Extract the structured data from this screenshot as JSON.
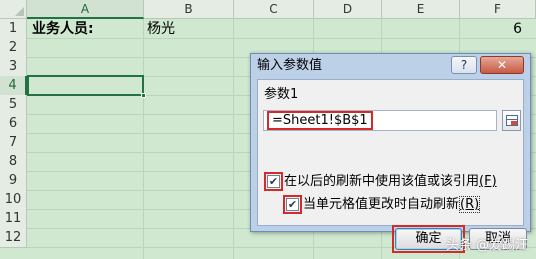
{
  "spreadsheet": {
    "columns": [
      "A",
      "B",
      "C",
      "D",
      "E",
      "F"
    ],
    "rows": [
      "1",
      "2",
      "3",
      "4",
      "5",
      "6",
      "7",
      "8",
      "9",
      "10",
      "11",
      "12"
    ],
    "active_column": "A",
    "active_row": "4",
    "cells": {
      "A1": "业务人员:",
      "B1": "杨光",
      "F1": "6"
    }
  },
  "dialog": {
    "title": "输入参数值",
    "help_label": "?",
    "close_label": "✕",
    "param_label": "参数1",
    "param_value": "=Sheet1!$B$1",
    "checkbox_use_value": {
      "label": "在以后的刷新中使用该值或该引用",
      "accel_suffix": "(F)",
      "checked": true
    },
    "checkbox_auto_refresh": {
      "label": "当单元格值更改时自动刷新",
      "accel_suffix": "(R)",
      "checked": true
    },
    "ok_label": "确定",
    "cancel_label": "取消"
  },
  "watermark": "头条 @爱踢汪",
  "colors": {
    "sheet_bg": "#cfe8cf",
    "highlight_red": "#d42a2a",
    "dialog_frame": "#bcd0e8",
    "excel_green": "#217346"
  },
  "icons": {
    "reference_button": "collapse-dialog-icon",
    "check_mark": "check-icon"
  }
}
